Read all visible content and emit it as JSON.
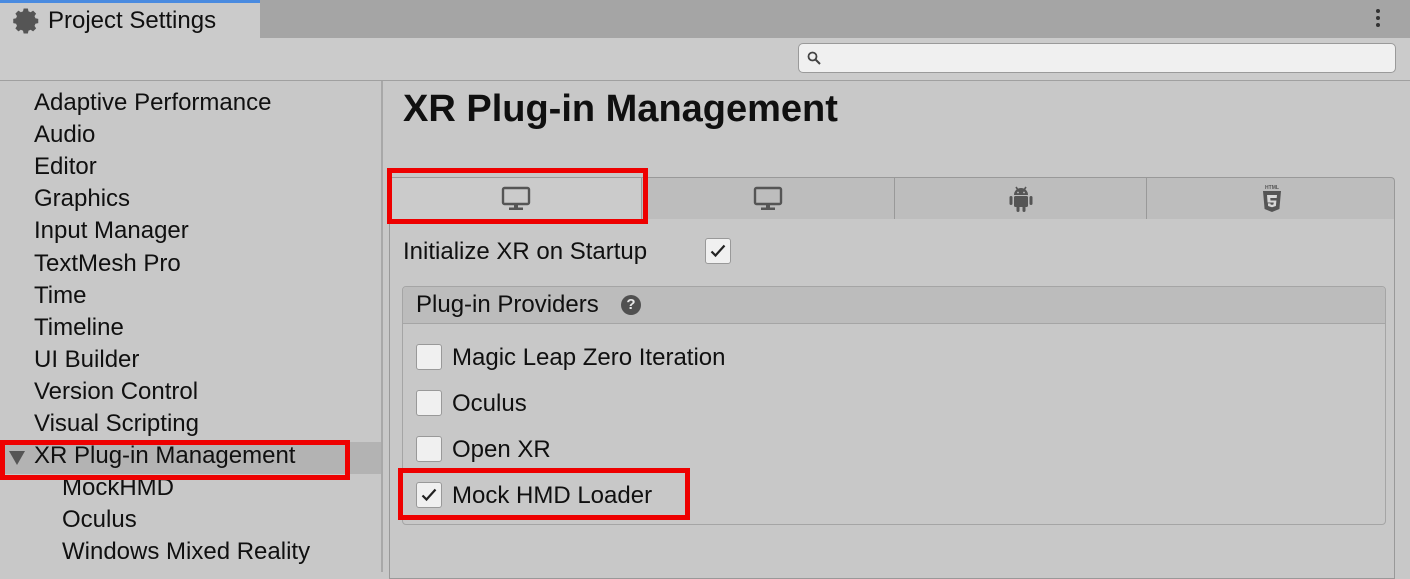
{
  "window": {
    "tab_title": "Project Settings"
  },
  "search": {
    "placeholder": "",
    "value": ""
  },
  "sidebar": {
    "items": [
      {
        "label": "Adaptive Performance"
      },
      {
        "label": "Audio"
      },
      {
        "label": "Editor"
      },
      {
        "label": "Graphics"
      },
      {
        "label": "Input Manager"
      },
      {
        "label": "TextMesh Pro"
      },
      {
        "label": "Time"
      },
      {
        "label": "Timeline"
      },
      {
        "label": "UI Builder"
      },
      {
        "label": "Version Control"
      },
      {
        "label": "Visual Scripting"
      },
      {
        "label": "XR Plug-in Management",
        "selected": true,
        "expanded": true
      }
    ],
    "sub_items": [
      {
        "label": "MockHMD"
      },
      {
        "label": "Oculus"
      },
      {
        "label": "Windows Mixed Reality"
      }
    ]
  },
  "main": {
    "title": "XR Plug-in Management",
    "platform_tabs": [
      {
        "icon": "desktop-icon",
        "selected": true
      },
      {
        "icon": "desktop-icon",
        "selected": false
      },
      {
        "icon": "android-icon",
        "selected": false
      },
      {
        "icon": "html5-icon",
        "selected": false
      }
    ],
    "initialize_xr": {
      "label": "Initialize XR on Startup",
      "checked": true
    },
    "providers": {
      "header": "Plug-in Providers",
      "items": [
        {
          "label": "Magic Leap Zero Iteration",
          "checked": false
        },
        {
          "label": "Oculus",
          "checked": false
        },
        {
          "label": "Open XR",
          "checked": false
        },
        {
          "label": "Mock HMD Loader",
          "checked": true
        }
      ]
    }
  },
  "colors": {
    "highlight": "#ee0000",
    "tab_accent": "#4a8be0"
  }
}
